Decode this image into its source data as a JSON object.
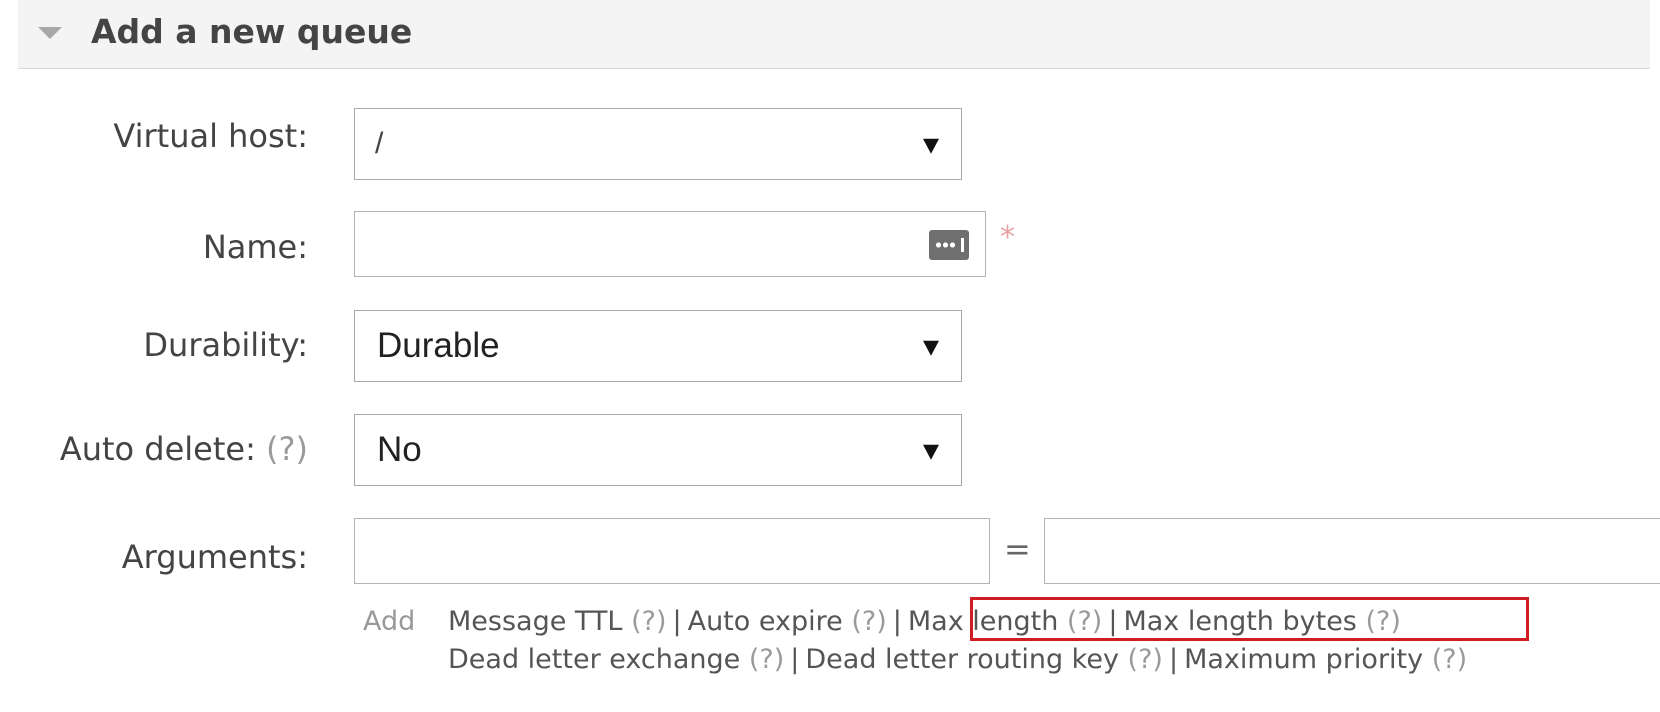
{
  "section": {
    "title": "Add a new queue"
  },
  "form": {
    "virtual_host": {
      "label": "Virtual host:",
      "value": "/"
    },
    "name": {
      "label": "Name:",
      "value": "",
      "required_mark": "*"
    },
    "durability": {
      "label": "Durability:",
      "value": "Durable"
    },
    "auto_delete": {
      "label": "Auto delete:",
      "help": "(?)",
      "value": "No"
    },
    "arguments": {
      "label": "Arguments:",
      "equals": "=",
      "key": "",
      "value": ""
    }
  },
  "argument_shortcuts": {
    "add_label": "Add",
    "help": "(?)",
    "separator": "|",
    "line1": [
      "Message TTL",
      "Auto expire",
      "Max length",
      "Max length bytes"
    ],
    "line2": [
      "Dead letter exchange",
      "Dead letter routing key",
      "Maximum priority"
    ]
  },
  "highlight": {
    "color": "#d01c24"
  }
}
